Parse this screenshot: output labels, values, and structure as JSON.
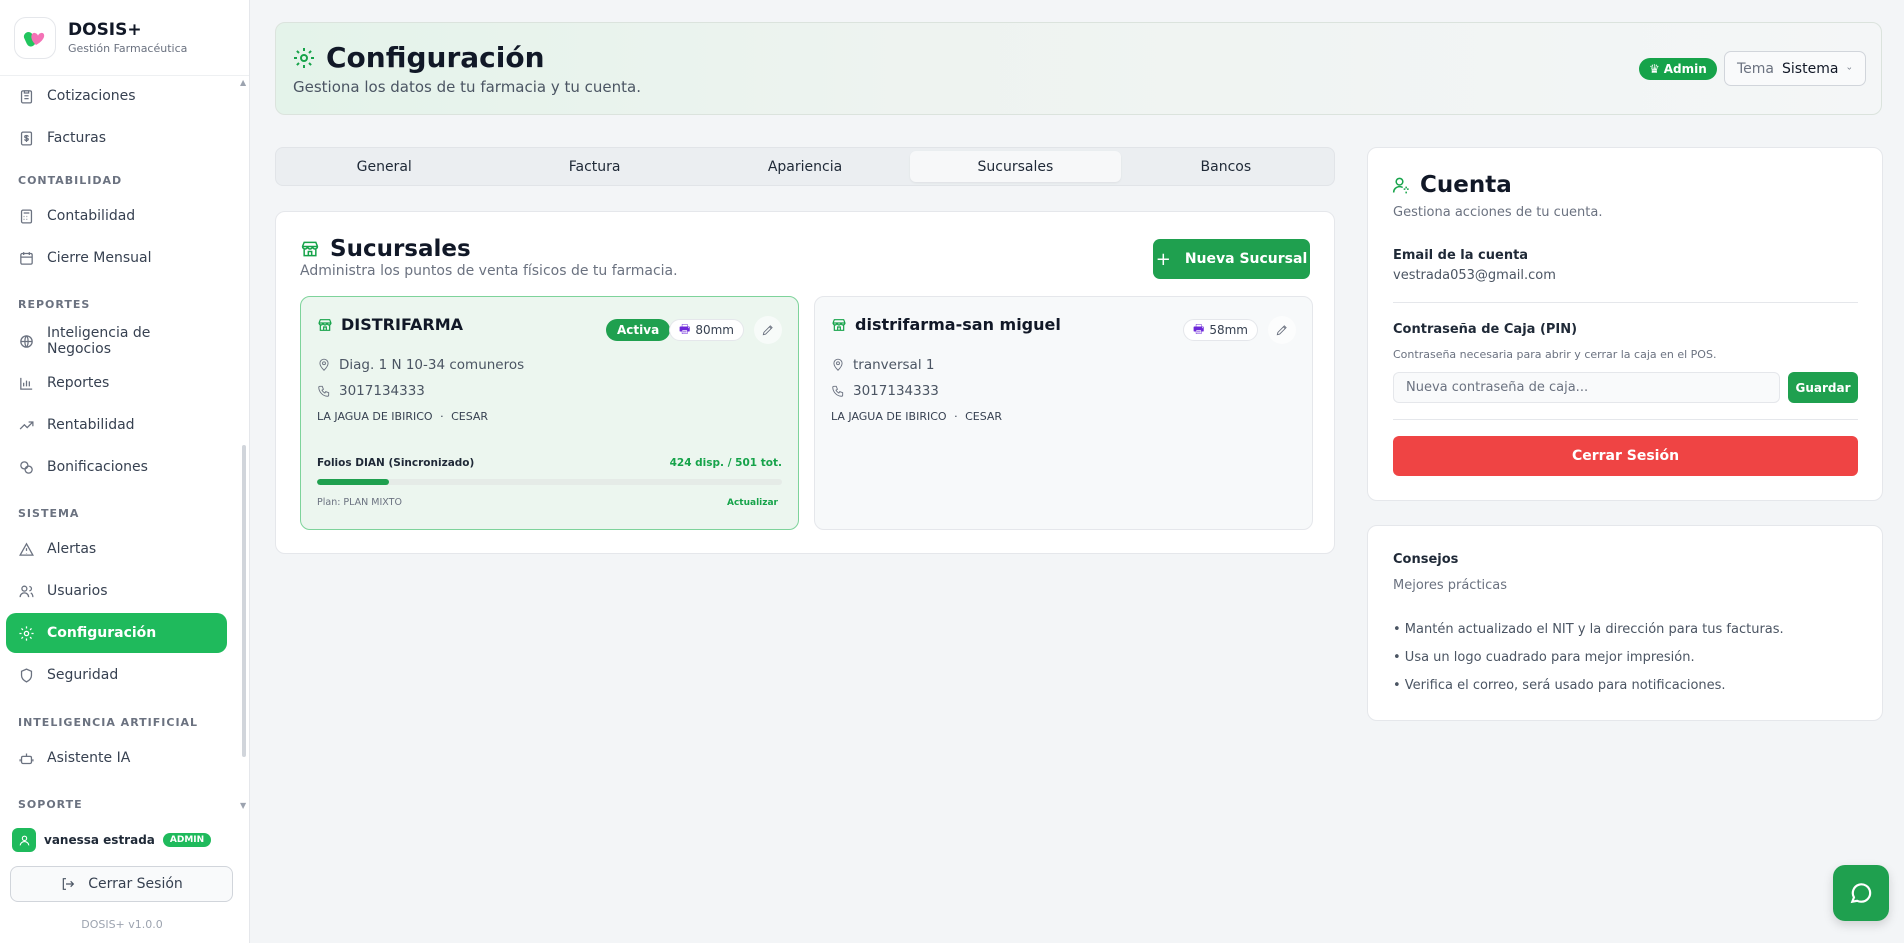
{
  "brand": {
    "title": "DOSIS+",
    "subtitle": "Gestión Farmacéutica",
    "version": "DOSIS+ v1.0.0"
  },
  "sidebar": {
    "items": [
      {
        "label": "Cotizaciones",
        "icon": "clipboard-icon"
      },
      {
        "label": "Facturas",
        "icon": "invoice-icon"
      },
      {
        "label": "Contabilidad",
        "icon": "calculator-icon"
      },
      {
        "label": "Cierre Mensual",
        "icon": "calendar-icon"
      },
      {
        "label": "Inteligencia de Negocios",
        "icon": "globe-icon"
      },
      {
        "label": "Reportes",
        "icon": "bar-chart-icon"
      },
      {
        "label": "Rentabilidad",
        "icon": "trending-up-icon"
      },
      {
        "label": "Bonificaciones",
        "icon": "coins-icon"
      },
      {
        "label": "Alertas",
        "icon": "warning-icon"
      },
      {
        "label": "Usuarios",
        "icon": "users-icon"
      },
      {
        "label": "Configuración",
        "icon": "gear-icon",
        "active": true
      },
      {
        "label": "Seguridad",
        "icon": "shield-icon"
      },
      {
        "label": "Asistente IA",
        "icon": "robot-icon"
      }
    ],
    "sections": [
      "CONTABILIDAD",
      "REPORTES",
      "SISTEMA",
      "INTELIGENCIA ARTIFICIAL",
      "SOPORTE"
    ],
    "user": {
      "name": "vanessa estrada",
      "role": "ADMIN"
    },
    "logout_label": "Cerrar Sesión"
  },
  "header": {
    "title": "Configuración",
    "subtitle": "Gestiona los datos de tu farmacia y tu cuenta.",
    "admin_badge": "Admin",
    "theme_label": "Tema",
    "theme_value": "Sistema"
  },
  "tabs": [
    {
      "label": "General"
    },
    {
      "label": "Factura"
    },
    {
      "label": "Apariencia"
    },
    {
      "label": "Sucursales",
      "active": true
    },
    {
      "label": "Bancos"
    }
  ],
  "sucursales": {
    "title": "Sucursales",
    "subtitle": "Administra los puntos de venta físicos de tu farmacia.",
    "new_button": "Nueva Sucursal",
    "branches": [
      {
        "name": "DISTRIFARMA",
        "status": "Activa",
        "paper": "80mm",
        "address": "Diag. 1 N 10-34 comuneros",
        "phone": "3017134333",
        "city": "LA JAGUA DE IBIRICO",
        "separator": "·",
        "department": "CESAR",
        "folios_label": "Folios DIAN (Sincronizado)",
        "folios_value": "424 disp. / 501 tot.",
        "folios_used_fraction": 0.154,
        "plan": "Plan: PLAN MIXTO",
        "update_label": "Actualizar"
      },
      {
        "name": "distrifarma-san miguel",
        "paper": "58mm",
        "address": "tranversal 1",
        "phone": "3017134333",
        "city": "LA JAGUA DE IBIRICO",
        "separator": "·",
        "department": "CESAR"
      }
    ]
  },
  "cuenta": {
    "title": "Cuenta",
    "subtitle": "Gestiona acciones de tu cuenta.",
    "email_label": "Email de la cuenta",
    "email_value": "vestrada053@gmail.com",
    "pin_label": "Contraseña de Caja (PIN)",
    "pin_help": "Contraseña necesaria para abrir y cerrar la caja en el POS.",
    "pin_placeholder": "Nueva contraseña de caja...",
    "save_button": "Guardar",
    "logout_button": "Cerrar Sesión"
  },
  "consejos": {
    "title": "Consejos",
    "subtitle": "Mejores prácticas",
    "tips": [
      "• Mantén actualizado el NIT y la dirección para tus facturas.",
      "• Usa un logo cuadrado para mejor impresión.",
      "• Verifica el correo, será usado para notificaciones."
    ]
  },
  "colors": {
    "accent": "#1fa04f",
    "danger": "#ef4444",
    "active_nav": "#1fba5c"
  }
}
